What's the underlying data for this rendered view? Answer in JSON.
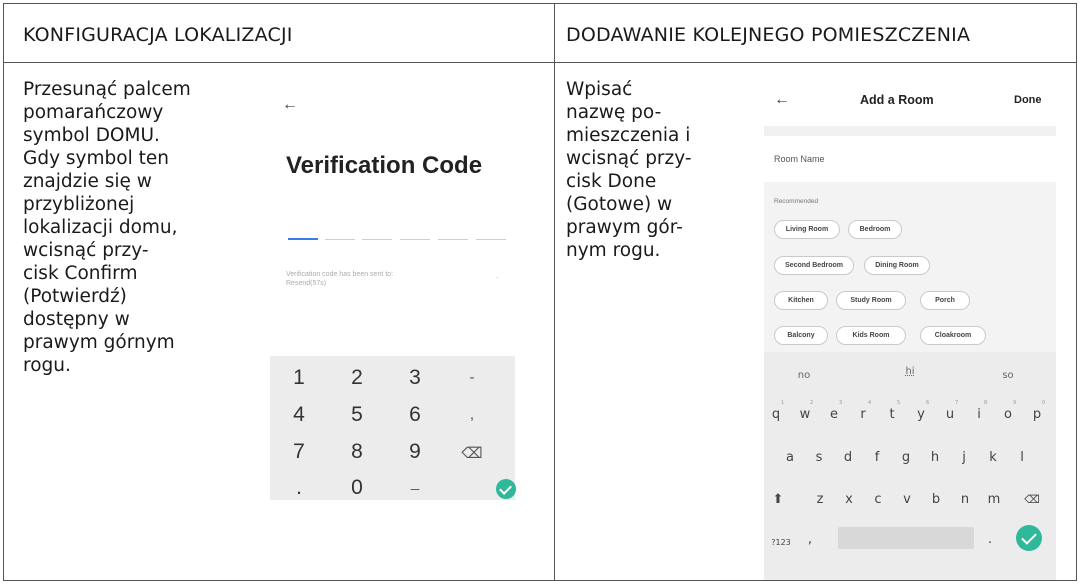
{
  "left": {
    "header": "KONFIGURACJA LOKALIZACJI",
    "instructions": "Przesunąć palcem\npomarańczowy\nsymbol DOMU.\nGdy symbol ten\nznajdzie się w\nprzybliżonej\nlokalizacji domu,\nwcisnąć przy-\ncisk Confirm\n(Potwierdź)\ndostępny w\nprawym górnym\nrogu."
  },
  "right": {
    "header": "DODAWANIE KOLEJNEGO POMIESZCZENIA",
    "instructions": "Wpisać\nnazwę po-\nmieszczenia i\nwcisnąć przy-\ncisk Done\n(Gotowe) w\nprawym gór-\nnym rogu."
  },
  "phone1": {
    "back_icon": "←",
    "title": "Verification Code",
    "note": "Verification code has been sent to:\nResend(57s)",
    "dash": "-",
    "keys": [
      "1",
      "2",
      "3",
      "-",
      "4",
      "5",
      "6",
      ",",
      "7",
      "8",
      "9",
      "⌫",
      ".",
      "0",
      "_",
      "✓"
    ]
  },
  "phone2": {
    "back_icon": "←",
    "title": "Add a Room",
    "done": "Done",
    "room_name_placeholder": "Room Name",
    "recommended_label": "Recommended",
    "chips": [
      "Living Room",
      "Bedroom",
      "Second Bedroom",
      "Dining Room",
      "Kitchen",
      "Study Room",
      "Porch",
      "Balcony",
      "Kids Room",
      "Cloakroom"
    ],
    "suggestions": [
      "no",
      "hi",
      "so"
    ],
    "row1": [
      "q",
      "w",
      "e",
      "r",
      "t",
      "y",
      "u",
      "i",
      "o",
      "p"
    ],
    "row1_nums": [
      "1",
      "2",
      "3",
      "4",
      "5",
      "6",
      "7",
      "8",
      "9",
      "0"
    ],
    "row2": [
      "a",
      "s",
      "d",
      "f",
      "g",
      "h",
      "j",
      "k",
      "l"
    ],
    "row3": [
      "z",
      "x",
      "c",
      "v",
      "b",
      "n",
      "m"
    ],
    "shift_icon": "⬆",
    "delete_icon": "⌫",
    "symbols_key": "?123",
    "comma_key": ",",
    "period_key": "."
  }
}
